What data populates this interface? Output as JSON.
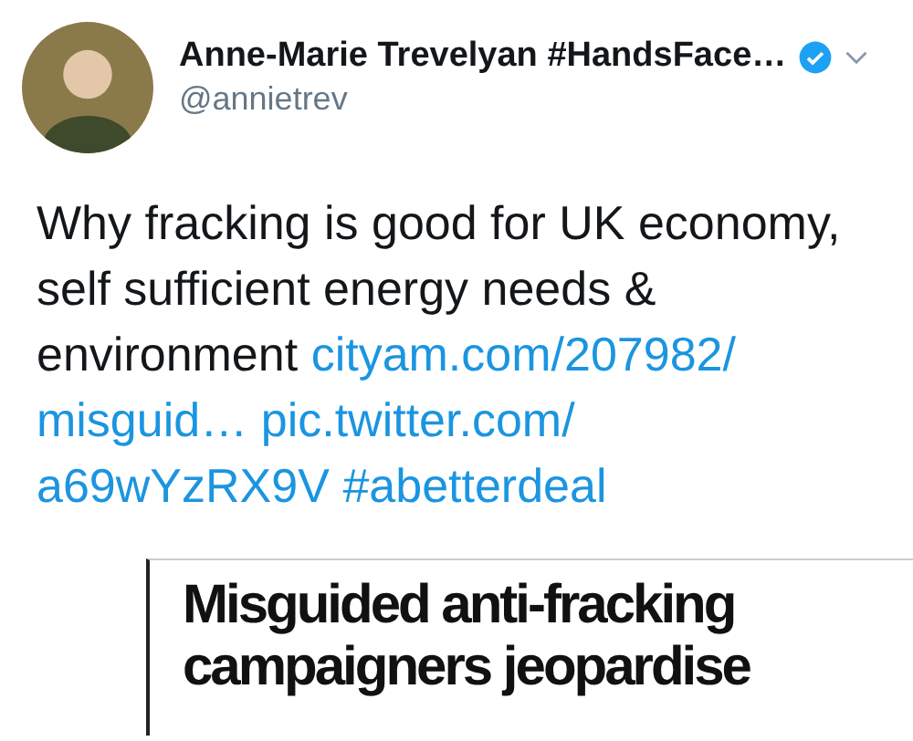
{
  "author": {
    "name": "Anne-Marie Trevelyan #HandsFace…",
    "verified": true,
    "handle": "@annietrev"
  },
  "tweet_lines": [
    [
      {
        "kind": "text",
        "text": "Why fracking is good for UK economy,"
      }
    ],
    [
      {
        "kind": "text",
        "text": "self sufficient energy needs &"
      }
    ],
    [
      {
        "kind": "text",
        "text": "environment "
      },
      {
        "kind": "link",
        "text": "cityam.com/207982/"
      }
    ],
    [
      {
        "kind": "link",
        "text": "misguid…"
      },
      {
        "kind": "link",
        "text": "pic.twitter.com/"
      }
    ],
    [
      {
        "kind": "link",
        "text": "a69wYzRX9V"
      },
      {
        "kind": "link",
        "text": "#abetterdeal"
      }
    ]
  ],
  "clipping": {
    "headline_lines": [
      "Misguided anti-fracking",
      "campaigners jeopardise"
    ]
  }
}
